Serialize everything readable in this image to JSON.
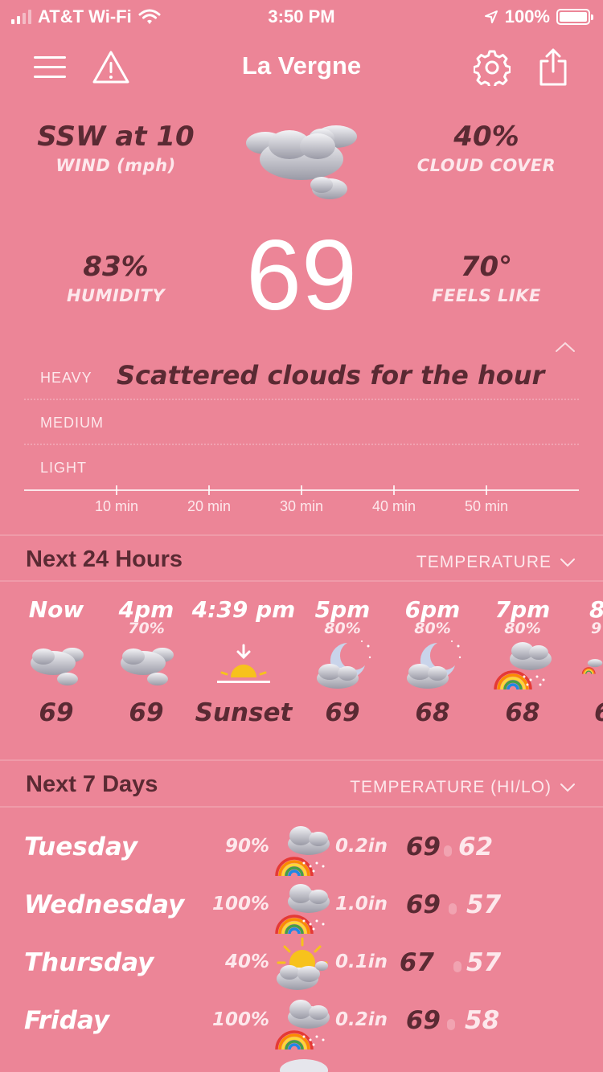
{
  "status_bar": {
    "carrier": "AT&T Wi-Fi",
    "time": "3:50 PM",
    "battery": "100%",
    "battery_level": 1.0
  },
  "nav": {
    "title": "La Vergne",
    "icons": [
      "menu-icon",
      "alert-icon",
      "gear-icon",
      "share-icon"
    ]
  },
  "current": {
    "wind_value": "SSW at 10",
    "wind_label": "WIND (mph)",
    "cloud_value": "40%",
    "cloud_label": "CLOUD COVER",
    "humidity_value": "83%",
    "humidity_label": "HUMIDITY",
    "feels_value": "70°",
    "feels_label": "FEELS LIKE",
    "temperature": "69",
    "icon": "cloudy-icon"
  },
  "precip": {
    "summary": "Scattered clouds for the hour",
    "levels": [
      "HEAVY",
      "MEDIUM",
      "LIGHT"
    ],
    "ticks": [
      "10 min",
      "20 min",
      "30 min",
      "40 min",
      "50 min"
    ]
  },
  "hourly": {
    "title": "Next 24 Hours",
    "selector": "TEMPERATURE",
    "items": [
      {
        "time": "Now",
        "pop": "",
        "icon": "cloudy-icon",
        "value": "69"
      },
      {
        "time": "4pm",
        "pop": "70%",
        "icon": "cloudy-icon",
        "value": "69"
      },
      {
        "time": "4:39 pm",
        "pop": "",
        "icon": "sunset-icon",
        "value": "Sunset"
      },
      {
        "time": "5pm",
        "pop": "80%",
        "icon": "moon-cloud-icon",
        "value": "69"
      },
      {
        "time": "6pm",
        "pop": "80%",
        "icon": "moon-cloud-icon",
        "value": "68"
      },
      {
        "time": "7pm",
        "pop": "80%",
        "icon": "rainbow-rain-icon",
        "value": "68"
      },
      {
        "time": "8",
        "pop": "9",
        "icon": "rainbow-rain-icon",
        "value": "6"
      }
    ]
  },
  "daily": {
    "title": "Next 7 Days",
    "selector": "TEMPERATURE (HI/LO)",
    "items": [
      {
        "day": "Tuesday",
        "pop": "90%",
        "icon": "rainbow-rain-icon",
        "amount": "0.2in",
        "hi": "69",
        "lo": "62"
      },
      {
        "day": "Wednesday",
        "pop": "100%",
        "icon": "rainbow-rain-icon",
        "amount": "1.0in",
        "hi": "69",
        "lo": "57"
      },
      {
        "day": "Thursday",
        "pop": "40%",
        "icon": "sun-cloud-icon",
        "amount": "0.1in",
        "hi": "67",
        "lo": "57"
      },
      {
        "day": "Friday",
        "pop": "100%",
        "icon": "rainbow-rain-icon",
        "amount": "0.2in",
        "hi": "69",
        "lo": "58"
      }
    ]
  }
}
